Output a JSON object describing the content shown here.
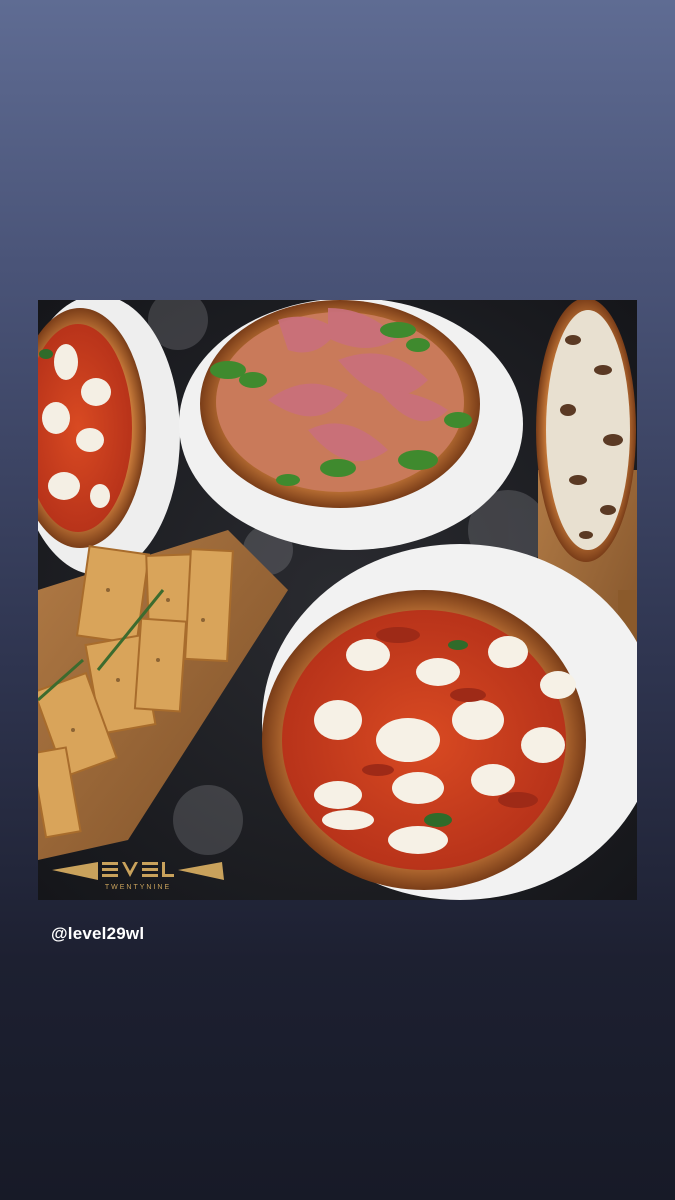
{
  "story": {
    "mention": "@level29wl",
    "photo": {
      "subject": "pizza-spread-photo",
      "logo_text": "TWENTYNINE"
    }
  },
  "colors": {
    "background_top": "#5f6c93",
    "background_bottom": "#171a27",
    "mention_text": "#ffffff"
  }
}
